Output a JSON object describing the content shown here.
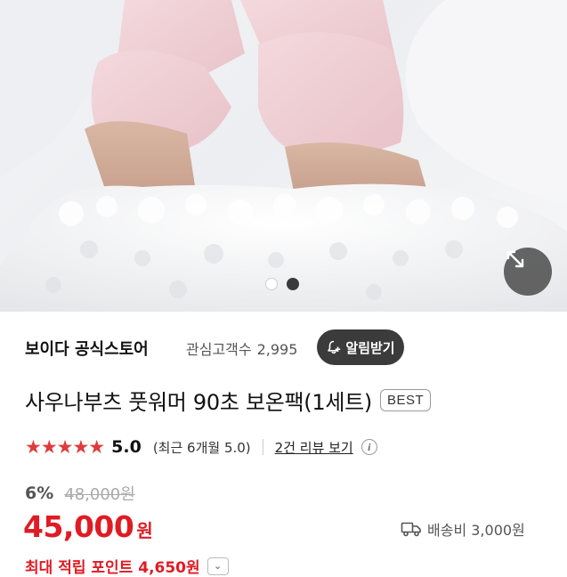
{
  "store": {
    "name": "보이다 공식스토어",
    "followers_label": "관심고객수",
    "followers_count": "2,995",
    "alarm_label": "알림받기"
  },
  "product": {
    "title": "사우나부츠 풋워머 90초 보온팩(1세트)",
    "badge": "BEST"
  },
  "rating": {
    "stars": "★★★★★",
    "score": "5.0",
    "recent": "(최근 6개월 5.0)",
    "review_link": "2건 리뷰 보기",
    "info_icon": "i"
  },
  "price": {
    "discount": "6%",
    "original": "48,000원",
    "sale": "45,000",
    "currency": "원"
  },
  "shipping": {
    "label": "배송비 3,000원",
    "icon": "truck-icon"
  },
  "points": {
    "label": "최대 적립 포인트 4,650원",
    "chevron": "⌄"
  },
  "gallery": {
    "dots": [
      "inactive",
      "active"
    ],
    "active_index": 1
  },
  "colors": {
    "price_red": "#e01b24",
    "star_red": "#e03b3b",
    "dark_button": "#3b3b3b"
  }
}
